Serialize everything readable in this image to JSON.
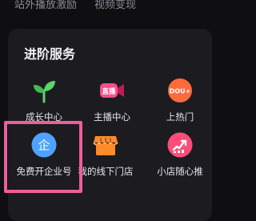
{
  "top_strip": {
    "left_text": "站外播放激励",
    "right_text": "视频变现"
  },
  "advanced_services": {
    "title": "进阶服务",
    "items": [
      {
        "label": "成长中心",
        "icon": "sprout-icon",
        "color": "#5dd36b"
      },
      {
        "label": "主播中心",
        "icon": "live-camera-icon",
        "color": "#ff4d88",
        "badge": "直播"
      },
      {
        "label": "上热门",
        "icon": "douyin-badge-icon",
        "color": "#ff6a3d",
        "badge": "DOU+"
      },
      {
        "label": "免费开企业号",
        "icon": "enterprise-icon",
        "color": "#4da3ff",
        "badge": "企"
      },
      {
        "label": "我的线下门店",
        "icon": "storefront-icon",
        "color": "#ff8a2a"
      },
      {
        "label": "小店随心推",
        "icon": "shop-promote-icon",
        "color": "#ff4d7a"
      }
    ]
  },
  "highlight_color": "#ef5d9a"
}
